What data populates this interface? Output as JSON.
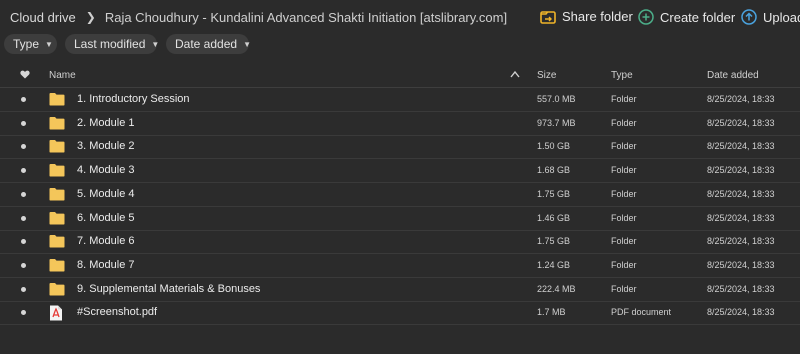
{
  "breadcrumb": {
    "root": "Cloud drive",
    "current": "Raja Choudhury - Kundalini Advanced Shakti Initiation [atslibrary.com]"
  },
  "actions": {
    "share": "Share folder",
    "create": "Create folder",
    "upload": "Upload..."
  },
  "filters": {
    "type": "Type",
    "modified": "Last modified",
    "date_added": "Date added"
  },
  "columns": {
    "name": "Name",
    "size": "Size",
    "type": "Type",
    "date_added": "Date added"
  },
  "colors": {
    "folder": "#f3c55a",
    "pdf": "#e53935",
    "share_icon": "#f0b429",
    "create_icon": "#4caf8a",
    "upload_icon": "#4aa3df"
  },
  "rows": [
    {
      "name": "1. Introductory Session",
      "size": "557.0 MB",
      "type": "Folder",
      "date": "8/25/2024, 18:33",
      "icon": "folder"
    },
    {
      "name": "2. Module 1",
      "size": "973.7 MB",
      "type": "Folder",
      "date": "8/25/2024, 18:33",
      "icon": "folder"
    },
    {
      "name": "3. Module 2",
      "size": "1.50 GB",
      "type": "Folder",
      "date": "8/25/2024, 18:33",
      "icon": "folder"
    },
    {
      "name": "4. Module 3",
      "size": "1.68 GB",
      "type": "Folder",
      "date": "8/25/2024, 18:33",
      "icon": "folder"
    },
    {
      "name": "5. Module 4",
      "size": "1.75 GB",
      "type": "Folder",
      "date": "8/25/2024, 18:33",
      "icon": "folder"
    },
    {
      "name": "6. Module 5",
      "size": "1.46 GB",
      "type": "Folder",
      "date": "8/25/2024, 18:33",
      "icon": "folder"
    },
    {
      "name": "7. Module 6",
      "size": "1.75 GB",
      "type": "Folder",
      "date": "8/25/2024, 18:33",
      "icon": "folder"
    },
    {
      "name": "8. Module 7",
      "size": "1.24 GB",
      "type": "Folder",
      "date": "8/25/2024, 18:33",
      "icon": "folder"
    },
    {
      "name": "9. Supplemental Materials & Bonuses",
      "size": "222.4 MB",
      "type": "Folder",
      "date": "8/25/2024, 18:33",
      "icon": "folder"
    },
    {
      "name": "#Screenshot.pdf",
      "size": "1.7 MB",
      "type": "PDF document",
      "date": "8/25/2024, 18:33",
      "icon": "pdf"
    }
  ]
}
